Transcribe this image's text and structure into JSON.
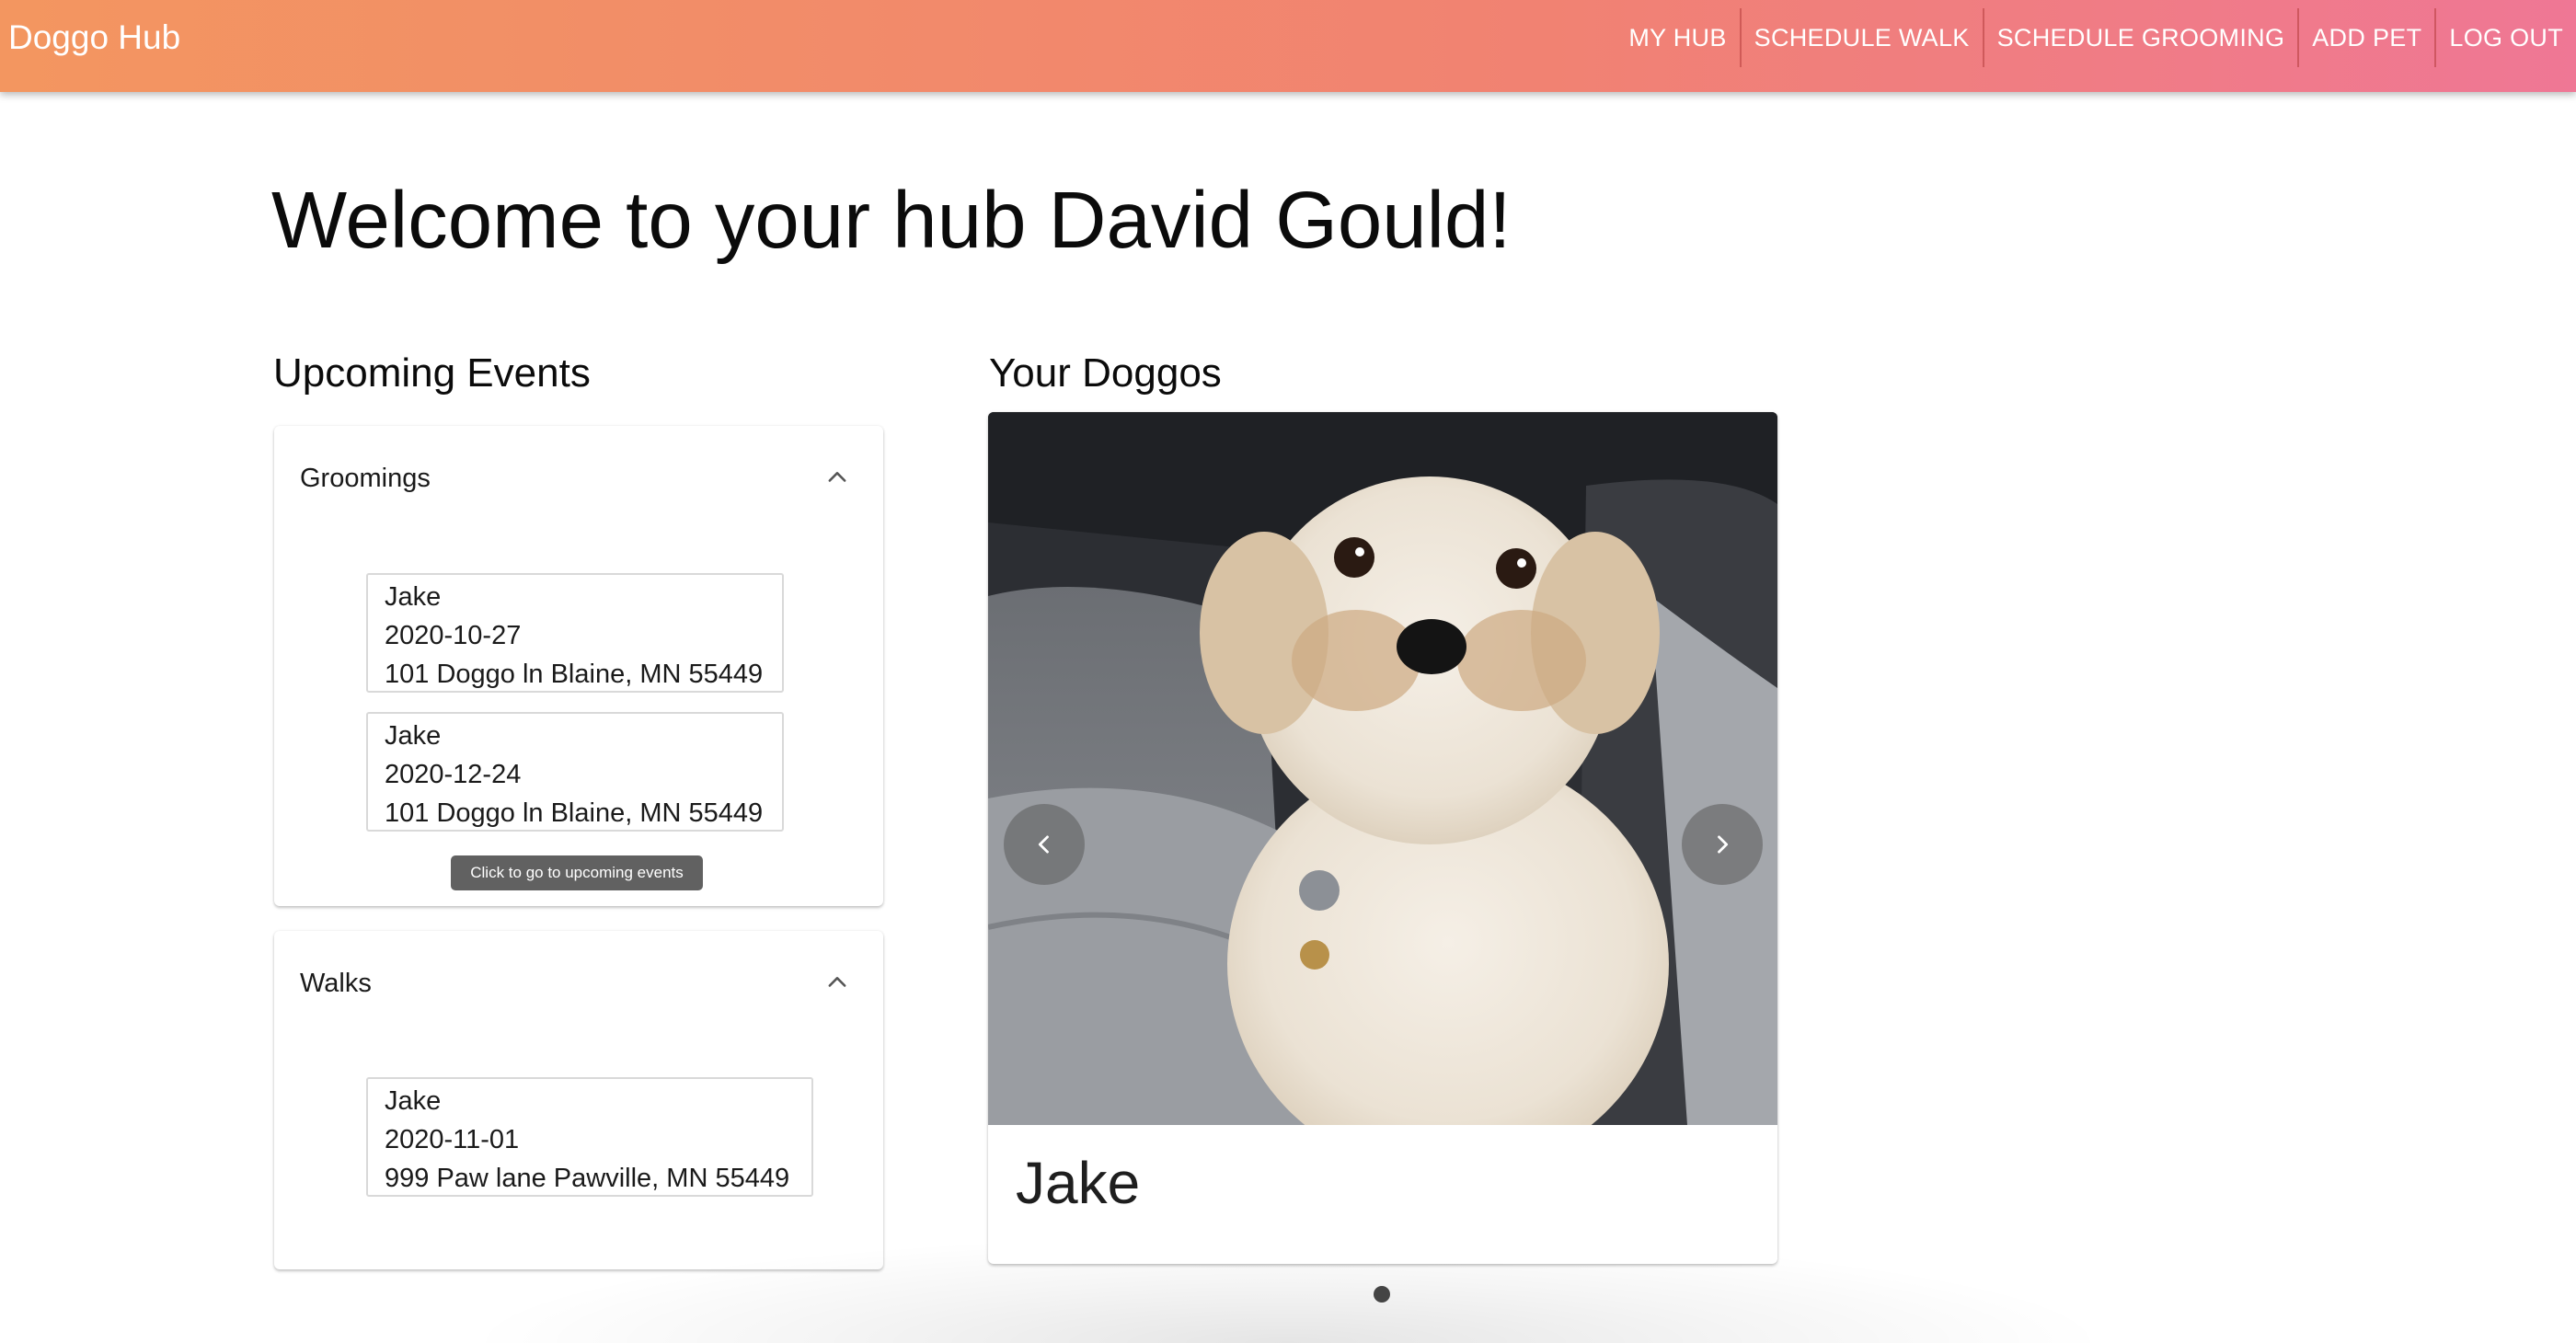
{
  "app": {
    "brand": "Doggo Hub"
  },
  "nav": {
    "items": [
      {
        "label": "MY HUB"
      },
      {
        "label": "SCHEDULE WALK"
      },
      {
        "label": "SCHEDULE GROOMING"
      },
      {
        "label": "ADD PET"
      },
      {
        "label": "LOG OUT"
      }
    ]
  },
  "page": {
    "welcome": "Welcome to your hub David Gould!"
  },
  "upcoming": {
    "title": "Upcoming Events",
    "groomings": {
      "title": "Groomings",
      "icon": "chevron-up-icon",
      "events": [
        {
          "pet": "Jake",
          "date": "2020-10-27",
          "address": "101 Doggo ln Blaine, MN 55449"
        },
        {
          "pet": "Jake",
          "date": "2020-12-24",
          "address": "101 Doggo ln Blaine, MN 55449"
        }
      ],
      "tooltip": "Click to go to upcoming events"
    },
    "walks": {
      "title": "Walks",
      "icon": "chevron-up-icon",
      "events": [
        {
          "pet": "Jake",
          "date": "2020-11-01",
          "address": "999 Paw lane Pawville, MN 55449"
        }
      ]
    }
  },
  "doggos": {
    "title": "Your Doggos",
    "current": {
      "name": "Jake",
      "photo": "white fluffy dog on car seat"
    },
    "prev_icon": "chevron-left-icon",
    "next_icon": "chevron-right-icon",
    "pagination": {
      "count": 1,
      "active": 1
    }
  },
  "colors": {
    "appbar_start": "#f39660",
    "appbar_end": "#ef7795",
    "tooltip_bg": "#616161"
  }
}
